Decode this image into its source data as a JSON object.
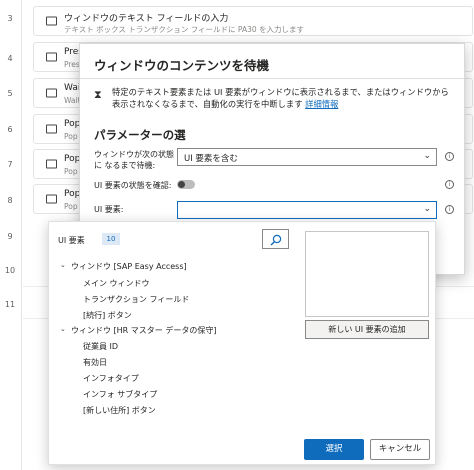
{
  "steps": {
    "numbers": [
      "3",
      "4",
      "5",
      "6",
      "7",
      "8",
      "9",
      "10",
      "11"
    ],
    "cards": [
      {
        "title": "ウィンドウのテキスト フィールドの入力",
        "subtitle": "テキスト ボックス トランザクション フィールドに PA30 を入力します"
      },
      {
        "title": "Pres",
        "subtitle": "Pres"
      },
      {
        "title": "Wai",
        "subtitle": "Wait"
      },
      {
        "title": "Pop",
        "subtitle": "Pop"
      },
      {
        "title": "Pop",
        "subtitle": "Pop"
      },
      {
        "title": "Pop",
        "subtitle": "Pop"
      }
    ]
  },
  "modal": {
    "title": "ウィンドウのコンテンツを待機",
    "description": "特定のテキスト要素または UI 要素がウィンドウに表示されるまで、またはウィンドウから表示されなくなるまで、自動化の実行を中断します",
    "details_link": "詳細情報",
    "section_title": "パラメーターの選",
    "params": {
      "wait_label": "ウィンドウが次の状態に なるまで待機:",
      "wait_value": "UI 要素を含む",
      "check_state_label": "UI 要素の状態を確認:",
      "check_state_on": false,
      "ui_element_label": "UI 要素:",
      "ui_element_value": ""
    }
  },
  "picker": {
    "header": "UI 要素",
    "count": "10",
    "tree": [
      {
        "label": "ウィンドウ [SAP Easy Access]",
        "level": 0,
        "expanded": true
      },
      {
        "label": "メイン ウィンドウ",
        "level": 1
      },
      {
        "label": "トランザクション フィールド",
        "level": 1
      },
      {
        "label": "[続行] ボタン",
        "level": 1
      },
      {
        "label": "ウィンドウ [HR マスター データの保守]",
        "level": 0,
        "expanded": true
      },
      {
        "label": "従業員 ID",
        "level": 1
      },
      {
        "label": "有効日",
        "level": 1
      },
      {
        "label": "インフォタイプ",
        "level": 1
      },
      {
        "label": "インフォ サブタイプ",
        "level": 1
      },
      {
        "label": "[新しい住所] ボタン",
        "level": 1
      }
    ],
    "add_button": "新しい UI 要素の追加",
    "select_button": "選択",
    "cancel_button": "キャンセル"
  },
  "colors": {
    "accent": "#0f6cbd",
    "border": "#8a8886"
  },
  "icons": [
    "window-icon",
    "hourglass-icon",
    "info-icon",
    "chevron-down-icon",
    "search-icon",
    "caret-down-icon"
  ]
}
